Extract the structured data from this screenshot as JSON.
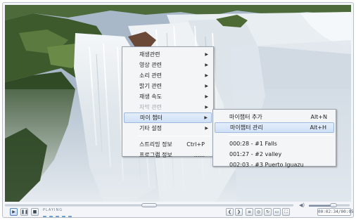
{
  "main_menu": {
    "items": [
      {
        "label": "재생관련",
        "submenu": true,
        "disabled": false
      },
      {
        "label": "영상 관련",
        "submenu": true,
        "disabled": false
      },
      {
        "label": "소리 관련",
        "submenu": true,
        "disabled": false
      },
      {
        "label": "밝기 관련",
        "submenu": true,
        "disabled": false
      },
      {
        "label": "재생 속도",
        "submenu": true,
        "disabled": false
      },
      {
        "label": "자막 관련",
        "submenu": true,
        "disabled": true
      },
      {
        "label": "마이 챕터",
        "submenu": true,
        "disabled": false,
        "highlighted": true
      },
      {
        "label": "기타 설정",
        "submenu": true,
        "disabled": false
      },
      {
        "label": "스트리밍 정보",
        "shortcut": "Ctrl+P"
      },
      {
        "label": "프로그램 정보",
        "shortcut": "......"
      }
    ]
  },
  "chapter_menu": {
    "items": [
      {
        "label": "마이챕터 추가",
        "shortcut": "Alt+N"
      },
      {
        "label": "마이챕터 관리",
        "shortcut": "Alt+H",
        "highlighted": true
      },
      {
        "label": "000:28 - #1 Falls"
      },
      {
        "label": "001:27 - #2 valley"
      },
      {
        "label": "002:03 - #3 Puerto Iguazu"
      }
    ]
  },
  "player": {
    "status": "PLAYING",
    "time": "00:02:34/00:05:03",
    "seek_fraction": 0.5,
    "volume_fraction": 0.6
  },
  "icons": {
    "play": "▶",
    "pause": "❚❚",
    "stop": "■",
    "volume": "◀)",
    "prev": "❮",
    "next": "❯",
    "list": "≡",
    "capture": "◎",
    "repeat": "↻",
    "window": "▭",
    "fullscreen": "⛶",
    "arrow": "▶"
  },
  "colors": {
    "menu_bg": "#f4f5f7",
    "highlight": "#cfe0f6",
    "highlight_border": "#9cb8de"
  }
}
